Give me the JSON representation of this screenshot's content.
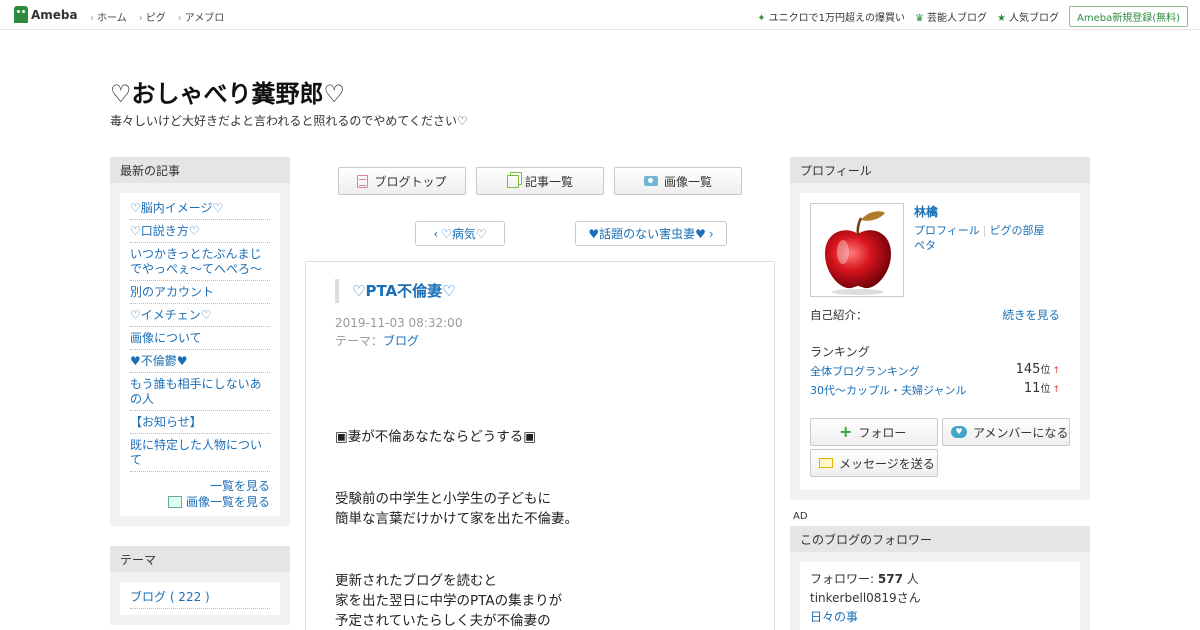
{
  "topbar": {
    "logo": "Ameba",
    "nav": [
      "ホーム",
      "ピグ",
      "アメブロ"
    ],
    "right_links": [
      {
        "icon": "sparkle-icon",
        "label": "ユニクロで1万円超えの爆買い"
      },
      {
        "icon": "crown-icon",
        "label": "芸能人ブログ"
      },
      {
        "icon": "star-icon",
        "label": "人気ブログ"
      }
    ],
    "signup": "Ameba新規登録(無料)"
  },
  "header": {
    "title": "♡おしゃべり糞野郎♡",
    "description": "毒々しいけど大好きだよと言われると照れるのでやめてください♡"
  },
  "left": {
    "recent": {
      "title": "最新の記事",
      "items": [
        "♡脳内イメージ♡",
        "♡口説き方♡",
        "いつかきっとたぶんまじでやっぺぇ～てへぺろ～",
        "別のアカウント",
        "♡イメチェン♡",
        "画像について",
        "♥不倫鬱♥",
        "もう誰も相手にしないあの人",
        "【お知らせ】",
        "既に特定した人物について"
      ],
      "more": "一覧を見る",
      "more_images": "画像一覧を見る"
    },
    "theme": {
      "title": "テーマ",
      "items": [
        "ブログ ( 222 )"
      ]
    }
  },
  "center": {
    "buttons": {
      "top": "ブログトップ",
      "list": "記事一覧",
      "images": "画像一覧"
    },
    "pager": {
      "prev": "♡病気♡",
      "next": "♥話題のない害虫妻♥"
    },
    "article": {
      "title": "♡PTA不倫妻♡",
      "date": "2019-11-03 08:32:00",
      "theme_label": "テーマ：",
      "theme": "ブログ",
      "paragraphs": [
        "▣妻が不倫あなたならどうする▣",
        "受験前の中学生と小学生の子どもに\n簡単な言葉だけかけて家を出た不倫妻。",
        "更新されたブログを読むと\n家を出た翌日に中学のPTAの集まりが\n予定されていたらしく夫が不倫妻の"
      ]
    }
  },
  "right": {
    "profile": {
      "title": "プロフィール",
      "name": "林檎",
      "links": [
        "プロフィール",
        "ピグの部屋",
        "ペタ"
      ],
      "intro_label": "自己紹介：",
      "intro_more": "続きを見る",
      "ranking_title": "ランキング",
      "rankings": [
        {
          "label": "全体ブログランキング",
          "value": "145",
          "unit": "位",
          "trend": "↑"
        },
        {
          "label": "30代〜カップル・夫婦ジャンル",
          "value": "11",
          "unit": "位",
          "trend": "↑"
        }
      ],
      "follow": "フォロー",
      "amember": "アメンバーになる",
      "message": "メッセージを送る"
    },
    "ad_label": "AD",
    "followers": {
      "title": "このブログのフォロワー",
      "count_label": "フォロワー:",
      "count": "577",
      "count_unit": "人",
      "user": "tinkerbell0819さん",
      "user_blog": "日々の事"
    }
  }
}
